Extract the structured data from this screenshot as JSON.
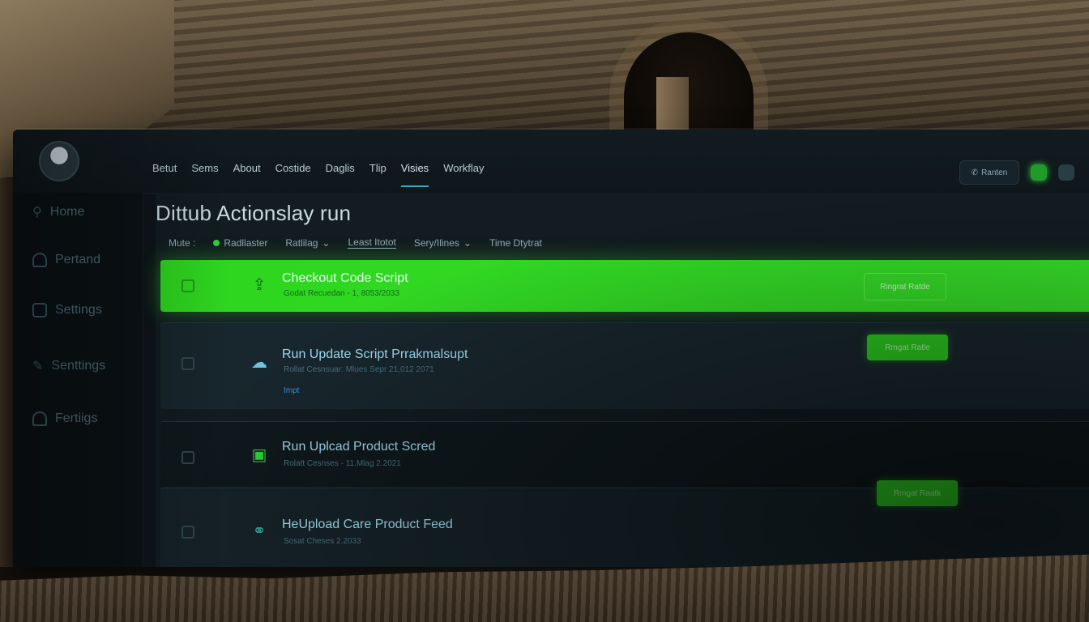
{
  "header": {
    "nav": [
      "Betut",
      "Sems",
      "About",
      "Costide",
      "Daglis",
      "Tlip",
      "Visies",
      "Workflay"
    ],
    "active_nav": "Visies",
    "search_button_label": "Ranten"
  },
  "sidebar": {
    "items": [
      {
        "label": "Home",
        "icon": "search-icon"
      },
      {
        "label": "Pertand",
        "icon": "user-icon"
      },
      {
        "label": "Settings",
        "icon": "grid-icon"
      },
      {
        "label": "Senttings",
        "icon": "pencil-icon"
      },
      {
        "label": "Fertiigs",
        "icon": "group-icon"
      }
    ]
  },
  "page": {
    "title": "Dittub Actionslay run",
    "filters": [
      {
        "label": "Mute :",
        "style": "plain"
      },
      {
        "label": "Radllaster",
        "style": "status"
      },
      {
        "label": "Ratlilag",
        "style": "dropdown"
      },
      {
        "label": "Least Itotot",
        "style": "underline"
      },
      {
        "label": "Sery/Ilines",
        "style": "dropdown"
      },
      {
        "label": "Time Dtytrat",
        "style": "plain"
      }
    ]
  },
  "runs": [
    {
      "title": "Checkout Code Script",
      "subtitle": "Godat Recuedan - 1, 8053/2033",
      "tag": "",
      "action": "Ringrat Ratde",
      "icon": "upload-icon",
      "highlight": true
    },
    {
      "title": "Run Update Script Prrakmalsupt",
      "subtitle": "Rollat Cesnsuar: Mlues Sepr 21,012 2071",
      "tag": "Impt",
      "action": "Rmgat Ratle",
      "icon": "cloud-icon",
      "highlight": false
    },
    {
      "title": "Run Uplcad Product Scred",
      "subtitle": "Rolatt Cesnses - 11.Mlag 2.2021",
      "tag": "",
      "action": "",
      "icon": "package-icon",
      "highlight": false
    },
    {
      "title": "HeUpload Care Product Feed",
      "subtitle": "Sosat Cheses 2.2033",
      "tag": "",
      "action": "Rmgat Raatk",
      "icon": "link-icon",
      "highlight": false
    }
  ],
  "colors": {
    "accent_green": "#2ed51f",
    "nav_active": "#3da7c7",
    "panel": "#121c21"
  }
}
